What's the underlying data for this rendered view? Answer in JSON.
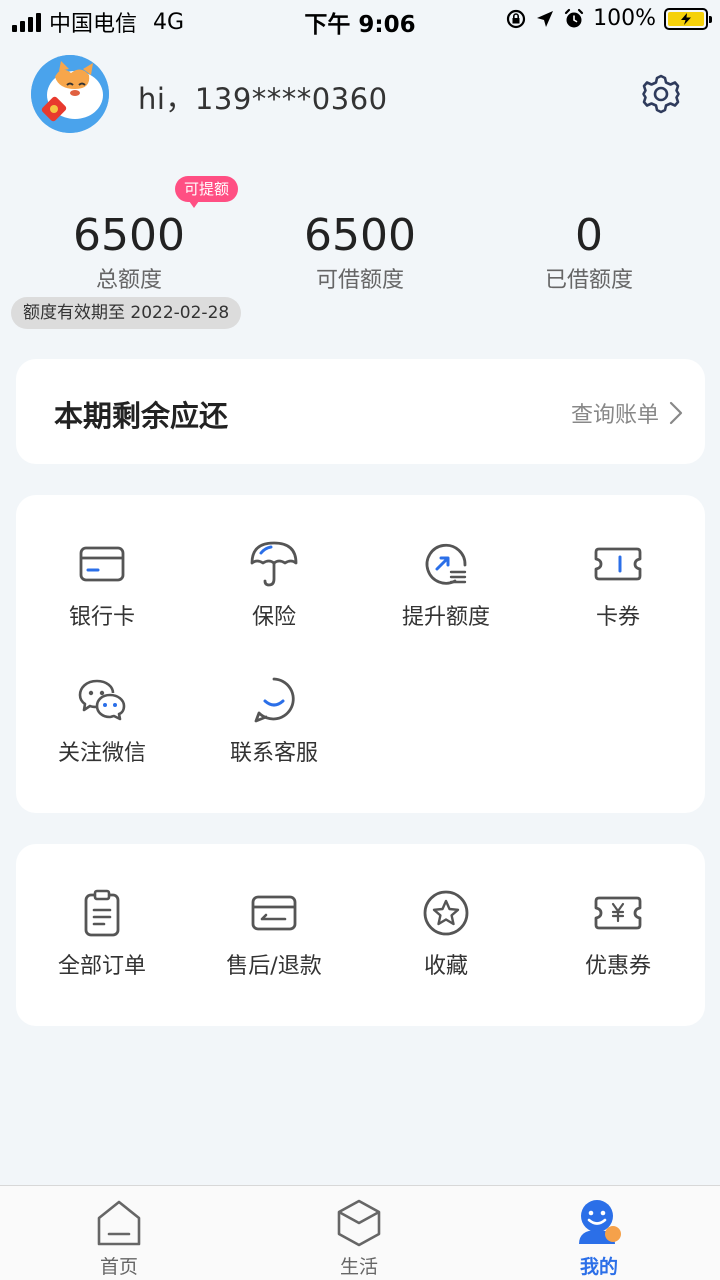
{
  "status_bar": {
    "carrier": "中国电信",
    "network": "4G",
    "time": "下午 9:06",
    "battery": "100%"
  },
  "header": {
    "greeting": "hi，139****0360"
  },
  "quota": {
    "badge": "可提额",
    "items": [
      {
        "value": "6500",
        "label": "总额度"
      },
      {
        "value": "6500",
        "label": "可借额度"
      },
      {
        "value": "0",
        "label": "已借额度"
      }
    ],
    "validity": "额度有效期至 2022-02-28"
  },
  "repay": {
    "title": "本期剩余应还",
    "link": "查询账单"
  },
  "services": [
    {
      "label": "银行卡",
      "icon": "bank-card-icon"
    },
    {
      "label": "保险",
      "icon": "umbrella-icon"
    },
    {
      "label": "提升额度",
      "icon": "gauge-icon"
    },
    {
      "label": "卡券",
      "icon": "ticket-icon"
    },
    {
      "label": "关注微信",
      "icon": "wechat-icon"
    },
    {
      "label": "联系客服",
      "icon": "smile-icon"
    }
  ],
  "orders": [
    {
      "label": "全部订单",
      "icon": "clipboard-icon"
    },
    {
      "label": "售后/退款",
      "icon": "refund-card-icon"
    },
    {
      "label": "收藏",
      "icon": "star-icon"
    },
    {
      "label": "优惠券",
      "icon": "yen-coupon-icon"
    }
  ],
  "tabs": [
    {
      "label": "首页",
      "icon": "home-icon",
      "active": false
    },
    {
      "label": "生活",
      "icon": "box-icon",
      "active": false
    },
    {
      "label": "我的",
      "icon": "user-icon",
      "active": true
    }
  ],
  "colors": {
    "accent": "#2b6fe8",
    "badge": "#ff4f83",
    "background": "#f2f6f9"
  }
}
